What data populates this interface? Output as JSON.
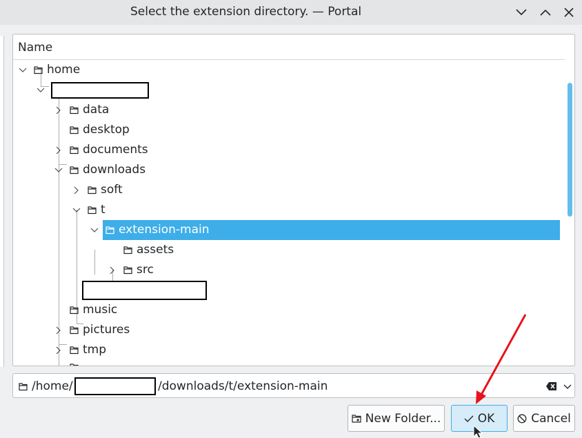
{
  "window": {
    "title": "Select the extension directory. — Portal"
  },
  "tree": {
    "column_header": "Name",
    "rows": [
      {
        "label": "home"
      },
      {
        "label": ""
      },
      {
        "label": "data"
      },
      {
        "label": "desktop"
      },
      {
        "label": "documents"
      },
      {
        "label": "downloads"
      },
      {
        "label": "soft"
      },
      {
        "label": "t"
      },
      {
        "label": "extension-main"
      },
      {
        "label": "assets"
      },
      {
        "label": "src"
      },
      {
        "label": ""
      },
      {
        "label": "music"
      },
      {
        "label": "pictures"
      },
      {
        "label": "tmp"
      }
    ]
  },
  "path": {
    "prefix": "/home/",
    "suffix": "/downloads/t/extension-main"
  },
  "buttons": {
    "new_folder": "New Folder...",
    "ok": "OK",
    "cancel": "Cancel"
  },
  "colors": {
    "selection": "#3daee9",
    "annotation_arrow": "#e8131b"
  },
  "icons": {
    "minimize": "chevron-down-icon",
    "maximize": "chevron-up-icon",
    "close": "close-icon",
    "folder": "folder-icon",
    "clear": "backspace-clear-icon",
    "dropdown": "chevron-down-icon",
    "ok": "check-icon",
    "cancel": "cancel-icon"
  }
}
